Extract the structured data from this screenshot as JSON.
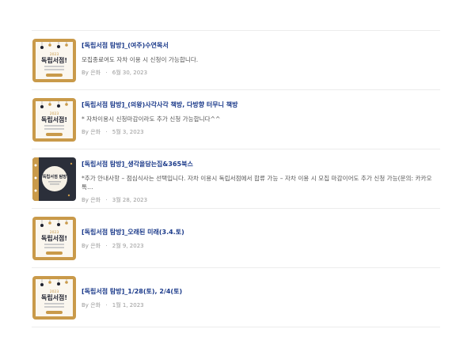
{
  "posts": [
    {
      "title": "[독립서점 탐방]_(여주)수연목서",
      "excerpt": "모집종료여도 자차 이용 시 신청이 가능합니다.",
      "by": "By",
      "author": "은화",
      "date": "6월 30, 2023",
      "thumb": {
        "style": "light",
        "headline": "독립서점!",
        "year": "2023"
      }
    },
    {
      "title": "[독립서점 탐방]_(의왕)사각사각 책방, 다방향 터무니 책방",
      "excerpt": "* 자차이용시 신청마감이라도 추가 신청 가능합니다^^",
      "by": "By",
      "author": "은화",
      "date": "5월 3, 2023",
      "thumb": {
        "style": "light",
        "headline": "독립서점!",
        "year": "2023"
      }
    },
    {
      "title": "[독립서점 탐방]_생각을담는집&365북스",
      "excerpt": "*추가 안내사항 – 점심식사는 선택입니다. 자차 이용시 독립서점에서 합류 가능 – 자차 이용 시 모집 마감이어도 추가 신청 가능(문의: 카카오톡…",
      "by": "By",
      "author": "은화",
      "date": "3월 28, 2023",
      "thumb": {
        "style": "dark",
        "headline": "독립서점 탐방",
        "year": ""
      }
    },
    {
      "title": "[독립서점 탐방]_오래된 미래(3.4.토)",
      "excerpt": "",
      "by": "By",
      "author": "은화",
      "date": "2월 9, 2023",
      "thumb": {
        "style": "light",
        "headline": "독립서점!",
        "year": "2023"
      }
    },
    {
      "title": "[독립서점 탐방]_1/28(토), 2/4(토)",
      "excerpt": "",
      "by": "By",
      "author": "은화",
      "date": "1월 1, 2023",
      "thumb": {
        "style": "light",
        "headline": "독립서점!",
        "year": "2023"
      }
    }
  ],
  "colors": {
    "title": "#1b3a8a",
    "meta": "#999999",
    "thumb_gold": "#c99a4a",
    "thumb_dark": "#2b2f3a"
  }
}
